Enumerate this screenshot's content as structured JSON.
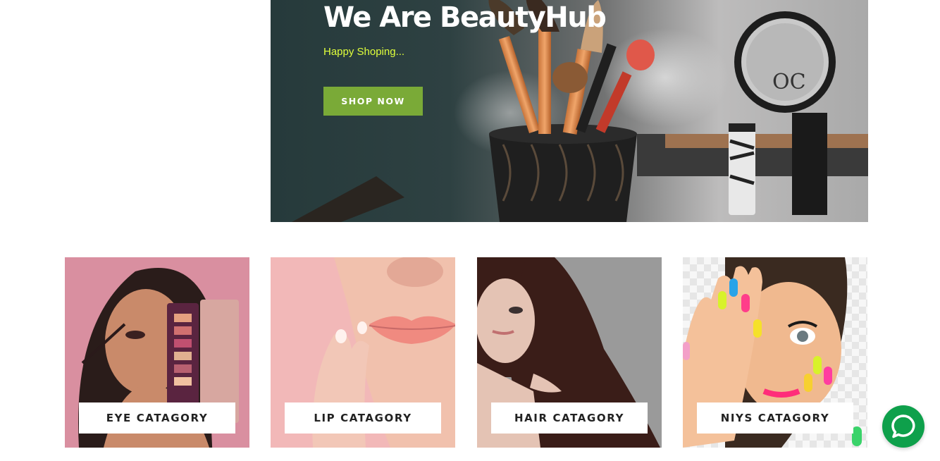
{
  "hero": {
    "title": "We Are BeautyHub",
    "subtitle": "Happy Shoping...",
    "cta_label": "SHOP NOW",
    "colors": {
      "cta_bg": "#7aaa37",
      "subtitle": "#e0ff3b",
      "title": "#ffffff"
    }
  },
  "categories": [
    {
      "label": "EYE CATAGORY",
      "image": "woman-with-eyeshadow-palette",
      "bg": "#d98fa0"
    },
    {
      "label": "LIP CATAGORY",
      "image": "lips-closeup",
      "bg": "#f2b8b8"
    },
    {
      "label": "HAIR CATAGORY",
      "image": "woman-long-hair",
      "bg": "#9a9a9a"
    },
    {
      "label": "NIYS CATAGORY",
      "image": "woman-colorful-nails",
      "bg": "#efefef"
    }
  ],
  "chat": {
    "icon": "chat-icon",
    "color": "#0ea04b"
  }
}
